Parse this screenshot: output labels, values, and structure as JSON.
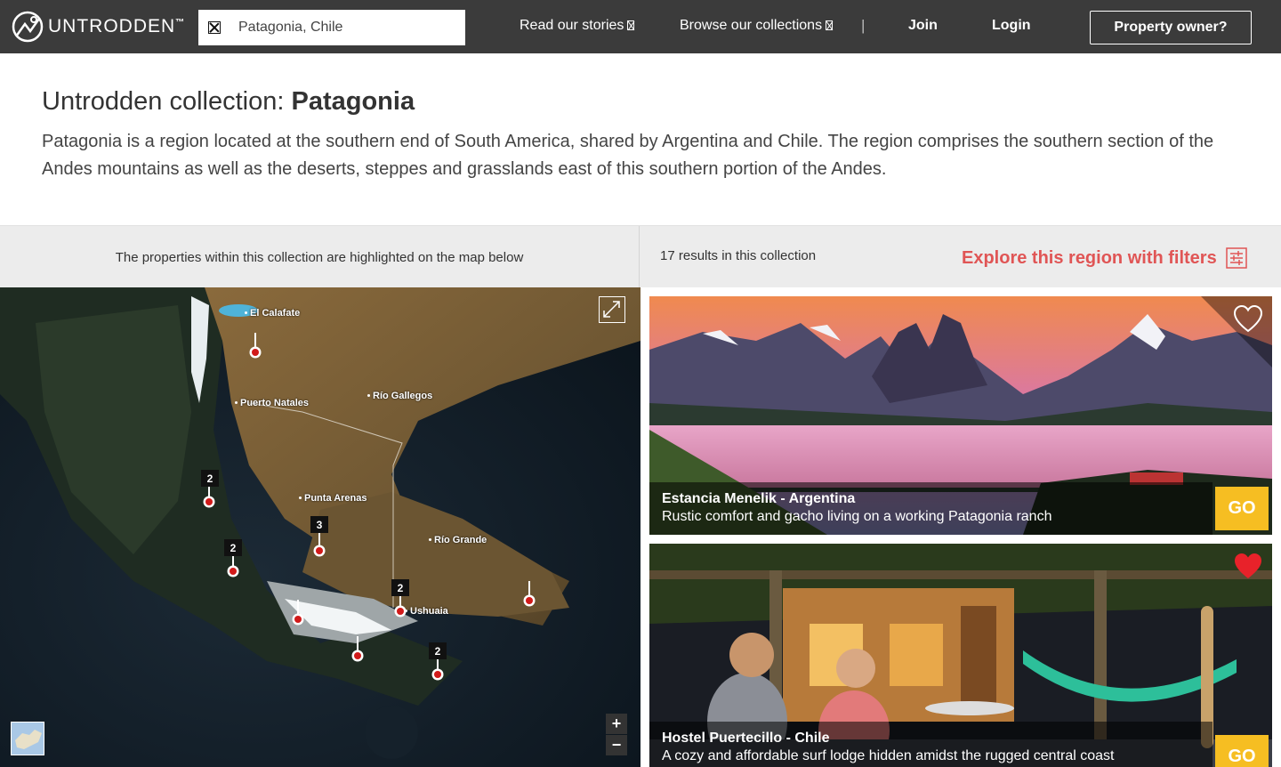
{
  "header": {
    "brand": "UNTRODDEN",
    "brand_tm": "™",
    "search_value": "Patagonia, Chile",
    "nav_stories": "Read our stories",
    "nav_collections": "Browse our collections",
    "separator": "|",
    "join": "Join",
    "login": "Login",
    "owner_button": "Property owner?"
  },
  "intro": {
    "title_prefix": "Untrodden collection: ",
    "title_strong": "Patagonia",
    "description": "Patagonia is a region located at the southern end of South America, shared by Argentina and Chile. The region comprises the southern section of the Andes mountains as well as the deserts, steppes and grasslands east of this southern portion of the Andes."
  },
  "infobar": {
    "map_note": "The properties within this collection are highlighted on the map below",
    "results": "17 results in this collection",
    "filters_link": "Explore this region with filters"
  },
  "map": {
    "places": [
      "El Calafate",
      "Río Gallegos",
      "Puerto Natales",
      "Punta Arenas",
      "Río Grande",
      "Ushuaia"
    ],
    "cluster_counts": [
      "2",
      "3",
      "2",
      "2",
      "2"
    ],
    "zoom_in": "+",
    "zoom_out": "−"
  },
  "listings": [
    {
      "title": "Estancia Menelik - Argentina",
      "description": "Rustic comfort and gacho living on a working Patagonia ranch",
      "go_label": "GO",
      "favorited": false
    },
    {
      "title": "Hostel Puertecillo - Chile",
      "description": "A cozy and affordable surf lodge hidden amidst the rugged central coast",
      "go_label": "GO",
      "favorited": true
    }
  ],
  "colors": {
    "topbar": "#3b3b3b",
    "accent_red": "#e05555",
    "go_yellow": "#f6be22",
    "heart_red": "#e8222a"
  }
}
